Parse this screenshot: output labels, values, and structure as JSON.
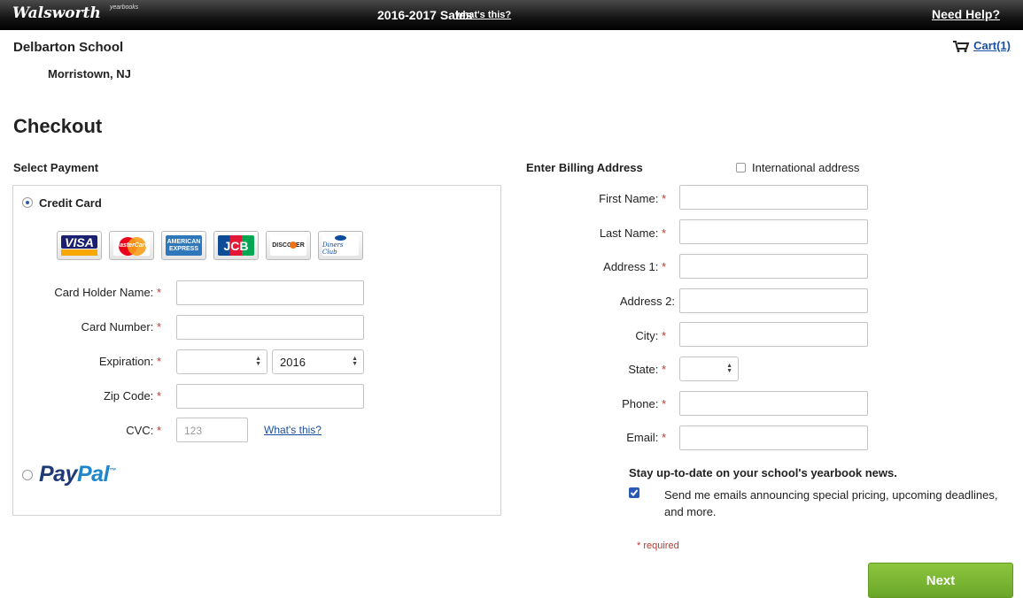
{
  "header": {
    "logo": "Walsworth",
    "logo_sub": "yearbooks",
    "sales_title": "2016-2017 Sales",
    "whats_this": "what's this?",
    "need_help": "Need Help?"
  },
  "school": {
    "name": "Delbarton School",
    "location": "Morristown, NJ"
  },
  "cart": {
    "label": "Cart(1)"
  },
  "page_title": "Checkout",
  "payment": {
    "section_title": "Select Payment",
    "credit_card_label": "Credit Card",
    "cards": [
      "VISA",
      "MasterCard",
      "AMERICAN EXPRESS",
      "JCB",
      "DISCOVER",
      "Diners Club"
    ],
    "fields": {
      "holder_label": "Card Holder Name:",
      "number_label": "Card Number:",
      "expiration_label": "Expiration:",
      "expiration_month": "",
      "expiration_year": "2016",
      "zip_label": "Zip Code:",
      "cvc_label": "CVC:",
      "cvc_placeholder": "123",
      "cvc_help": "What's this?"
    },
    "paypal_label_1": "Pay",
    "paypal_label_2": "Pal",
    "paypal_tm": "™"
  },
  "billing": {
    "section_title": "Enter Billing Address",
    "international_label": "International address",
    "fields": [
      {
        "label": "First Name:",
        "required": true
      },
      {
        "label": "Last Name:",
        "required": true
      },
      {
        "label": "Address 1:",
        "required": true
      },
      {
        "label": "Address 2:",
        "required": false
      },
      {
        "label": "City:",
        "required": true
      },
      {
        "label": "State:",
        "required": true
      },
      {
        "label": "Phone:",
        "required": true
      },
      {
        "label": "Email:",
        "required": true
      }
    ],
    "required_mark": "*",
    "newsletter_title": "Stay up-to-date on your school's yearbook news.",
    "newsletter_text": "Send me emails announcing special pricing, upcoming deadlines, and more.",
    "newsletter_checked": true,
    "required_note": "required"
  },
  "next_button": "Next"
}
